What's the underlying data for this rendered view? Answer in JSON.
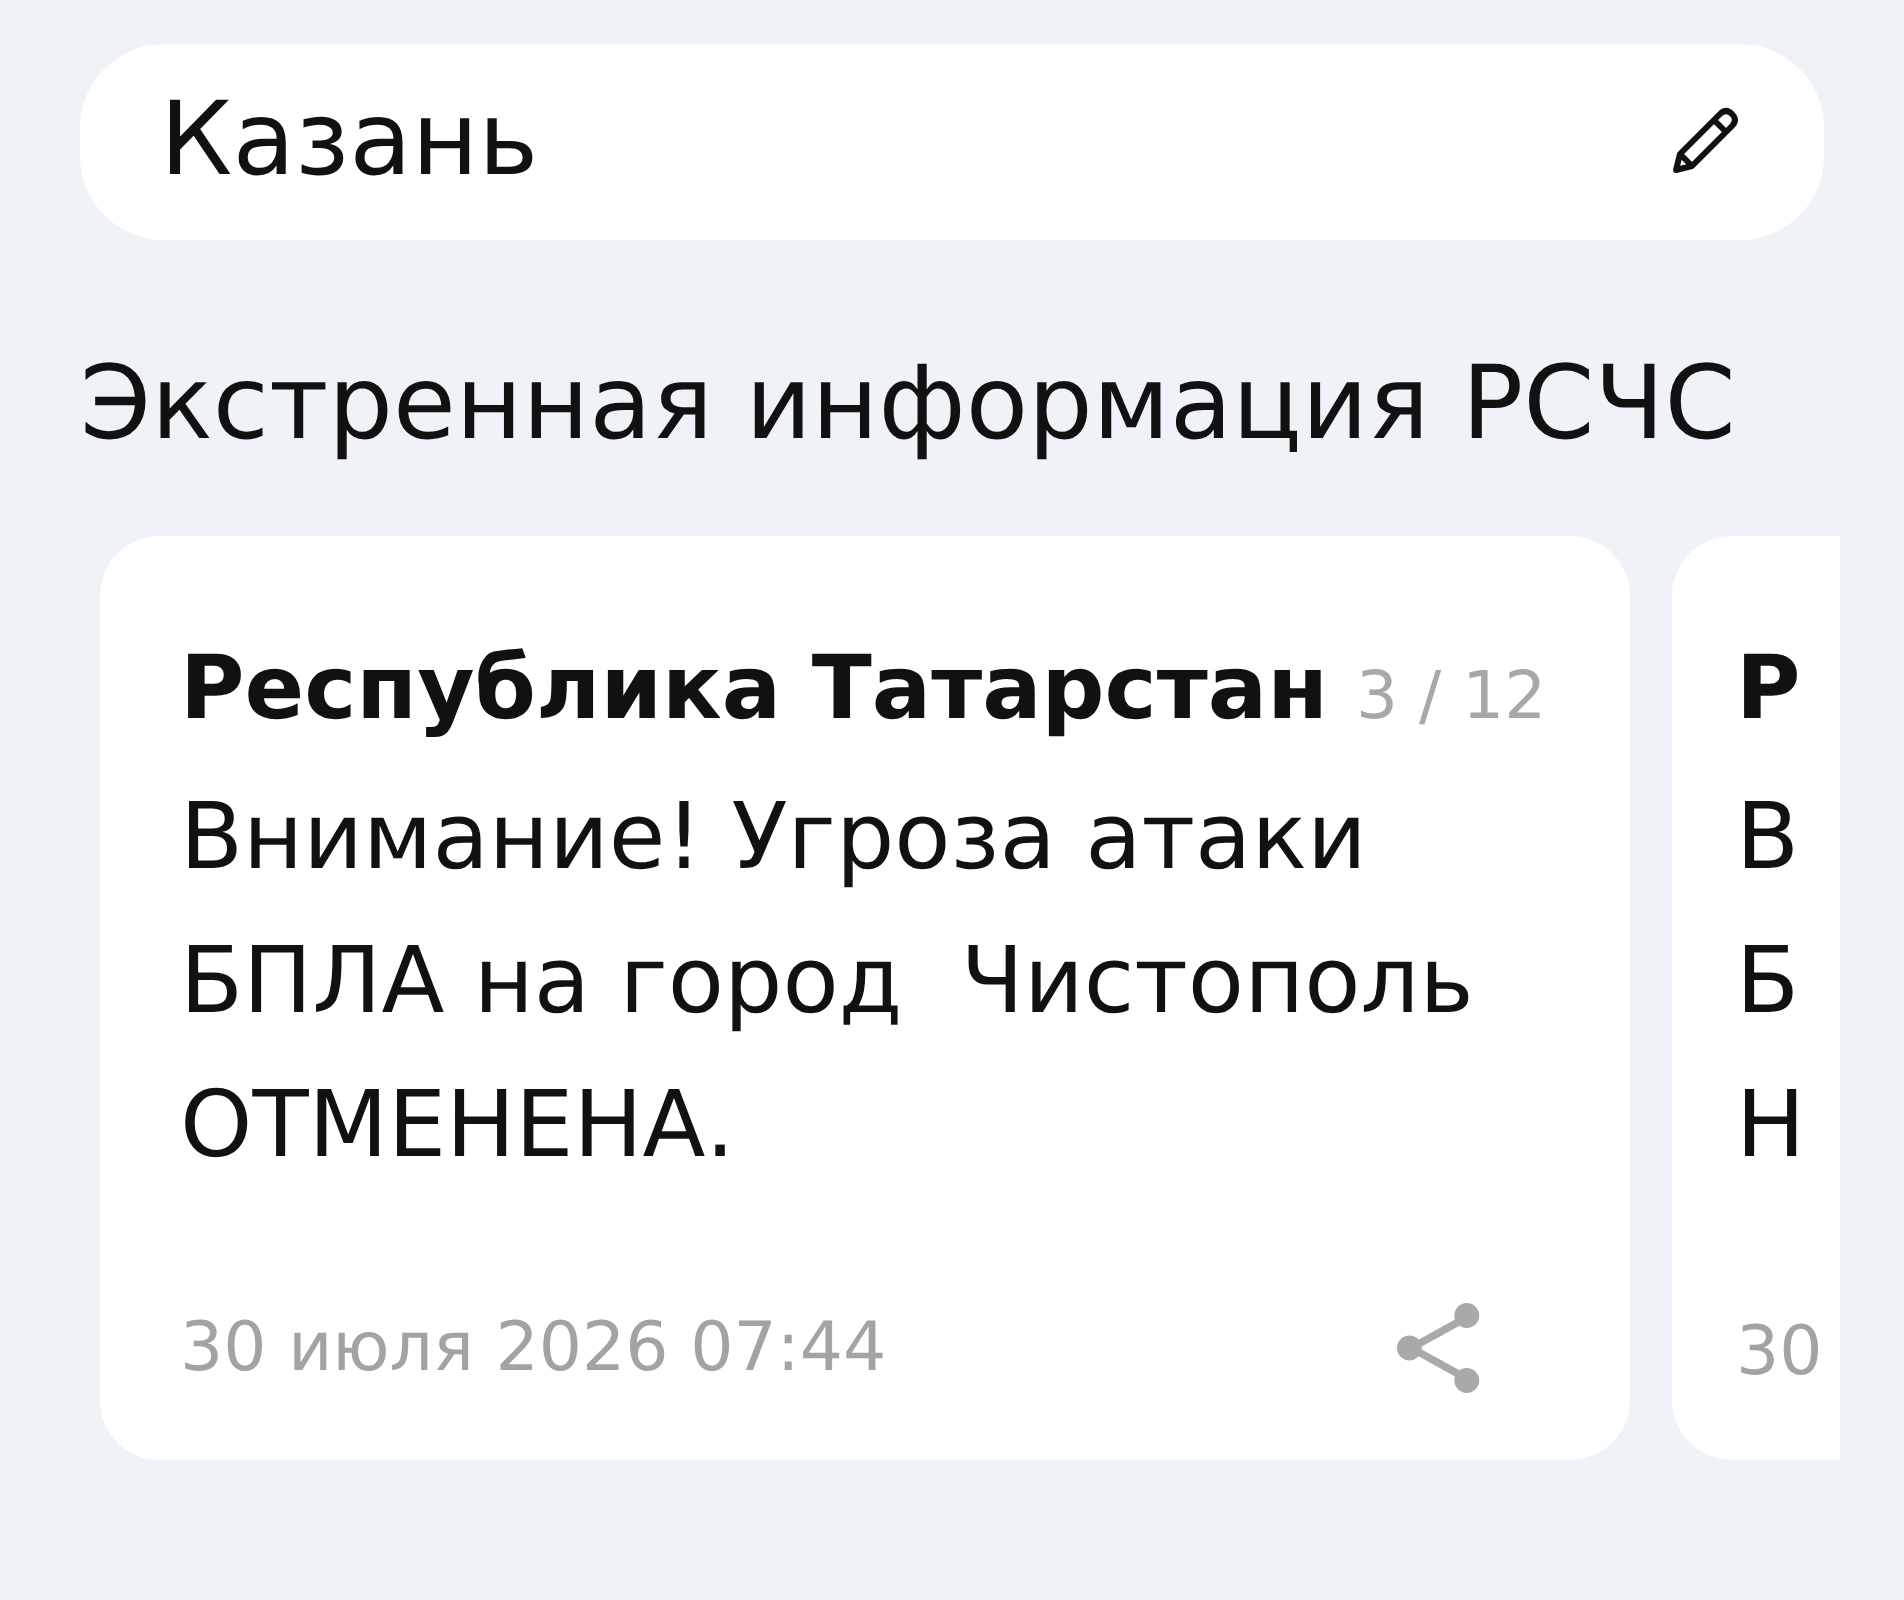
{
  "city_field": {
    "value": "Казань"
  },
  "section": {
    "title": "Экстренная информация РСЧС"
  },
  "cards": [
    {
      "kind": "full",
      "title": "Республика Татарстан",
      "counter": "3 / 12",
      "body": "Внимание! Угроза атаки\nБПЛА на город  Чистополь\nОТМЕНЕНА.",
      "date": "30 июля 2026 07:44"
    },
    {
      "kind": "partial",
      "title": "Р",
      "body": "В\nБ\nН",
      "date": "30"
    }
  ]
}
